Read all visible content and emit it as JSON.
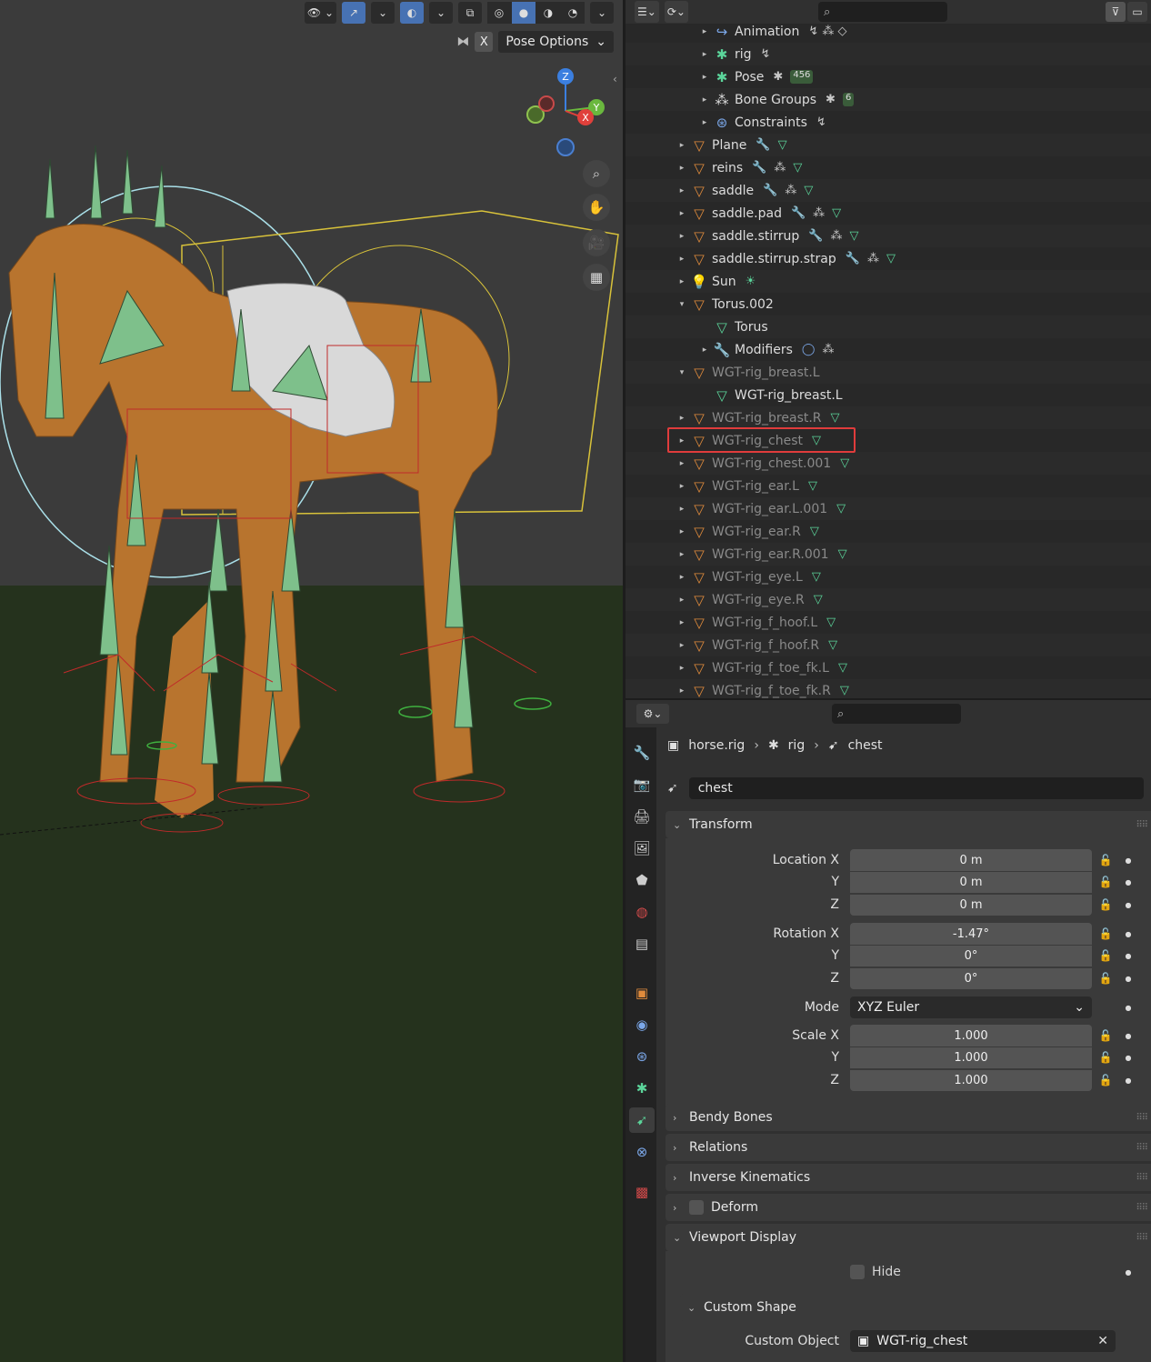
{
  "viewport": {
    "header_icons": [
      "visibility-icon",
      "gizmo-icon",
      "overlay-icon",
      "xray-icon",
      "wireframe-icon",
      "solid-icon",
      "material-icon",
      "rendered-icon"
    ],
    "x_toggle": "X",
    "pose_options": "Pose Options",
    "gizmo": {
      "z": "Z",
      "y": "Y",
      "x": "X"
    }
  },
  "outliner": {
    "rows": [
      {
        "label": "Animation",
        "icon": "animation-icon",
        "indent": 2,
        "expand": "▸"
      },
      {
        "label": "rig",
        "icon": "armature-icon",
        "indent": 2,
        "expand": "▸"
      },
      {
        "label": "Pose",
        "icon": "pose-icon",
        "indent": 2,
        "expand": "▸",
        "badge": "456"
      },
      {
        "label": "Bone Groups",
        "icon": "bone-groups-icon",
        "indent": 2,
        "expand": "▸",
        "badge": "6"
      },
      {
        "label": "Constraints",
        "icon": "constraints-icon",
        "indent": 2,
        "expand": "▸"
      },
      {
        "label": "Plane",
        "icon": "mesh-icon",
        "indent": 1,
        "expand": "▸"
      },
      {
        "label": "reins",
        "icon": "mesh-icon",
        "indent": 1,
        "expand": "▸"
      },
      {
        "label": "saddle",
        "icon": "mesh-icon",
        "indent": 1,
        "expand": "▸"
      },
      {
        "label": "saddle.pad",
        "icon": "mesh-icon",
        "indent": 1,
        "expand": "▸"
      },
      {
        "label": "saddle.stirrup",
        "icon": "mesh-icon",
        "indent": 1,
        "expand": "▸"
      },
      {
        "label": "saddle.stirrup.strap",
        "icon": "mesh-icon",
        "indent": 1,
        "expand": "▸"
      },
      {
        "label": "Sun",
        "icon": "light-icon",
        "indent": 1,
        "expand": "▸"
      },
      {
        "label": "Torus.002",
        "icon": "mesh-icon",
        "indent": 1,
        "expand": "▾"
      },
      {
        "label": "Torus",
        "icon": "mesh-data-icon",
        "indent": 2,
        "expand": ""
      },
      {
        "label": "Modifiers",
        "icon": "modifier-icon",
        "indent": 2,
        "expand": "▸"
      },
      {
        "label": "WGT-rig_breast.L",
        "icon": "mesh-icon",
        "indent": 1,
        "expand": "▾",
        "dim": true
      },
      {
        "label": "WGT-rig_breast.L",
        "icon": "mesh-data-icon",
        "indent": 2,
        "expand": ""
      },
      {
        "label": "WGT-rig_breast.R",
        "icon": "mesh-icon",
        "indent": 1,
        "expand": "▸",
        "dim": true
      },
      {
        "label": "WGT-rig_chest",
        "icon": "mesh-icon",
        "indent": 1,
        "expand": "▸",
        "dim": true
      },
      {
        "label": "WGT-rig_chest.001",
        "icon": "mesh-icon",
        "indent": 1,
        "expand": "▸",
        "dim": true
      },
      {
        "label": "WGT-rig_ear.L",
        "icon": "mesh-icon",
        "indent": 1,
        "expand": "▸",
        "dim": true
      },
      {
        "label": "WGT-rig_ear.L.001",
        "icon": "mesh-icon",
        "indent": 1,
        "expand": "▸",
        "dim": true
      },
      {
        "label": "WGT-rig_ear.R",
        "icon": "mesh-icon",
        "indent": 1,
        "expand": "▸",
        "dim": true
      },
      {
        "label": "WGT-rig_ear.R.001",
        "icon": "mesh-icon",
        "indent": 1,
        "expand": "▸",
        "dim": true
      },
      {
        "label": "WGT-rig_eye.L",
        "icon": "mesh-icon",
        "indent": 1,
        "expand": "▸",
        "dim": true
      },
      {
        "label": "WGT-rig_eye.R",
        "icon": "mesh-icon",
        "indent": 1,
        "expand": "▸",
        "dim": true
      },
      {
        "label": "WGT-rig_f_hoof.L",
        "icon": "mesh-icon",
        "indent": 1,
        "expand": "▸",
        "dim": true
      },
      {
        "label": "WGT-rig_f_hoof.R",
        "icon": "mesh-icon",
        "indent": 1,
        "expand": "▸",
        "dim": true
      },
      {
        "label": "WGT-rig_f_toe_fk.L",
        "icon": "mesh-icon",
        "indent": 1,
        "expand": "▸",
        "dim": true
      },
      {
        "label": "WGT-rig_f_toe_fk.R",
        "icon": "mesh-icon",
        "indent": 1,
        "expand": "▸",
        "dim": true
      }
    ]
  },
  "properties": {
    "breadcrumb": [
      "horse.rig",
      "rig",
      "chest"
    ],
    "bone_name": "chest",
    "transform": {
      "title": "Transform",
      "location_label": "Location X",
      "location": [
        "0 m",
        "0 m",
        "0 m"
      ],
      "rotation_label": "Rotation X",
      "rotation": [
        "-1.47°",
        "0°",
        "0°"
      ],
      "mode_label": "Mode",
      "mode": "XYZ Euler",
      "scale_label": "Scale X",
      "scale": [
        "1.000",
        "1.000",
        "1.000"
      ],
      "y_label": "Y",
      "z_label": "Z"
    },
    "panels": {
      "bendy": "Bendy Bones",
      "relations": "Relations",
      "ik": "Inverse Kinematics",
      "deform": "Deform",
      "viewport_display": "Viewport Display",
      "hide": "Hide",
      "custom_shape": "Custom Shape",
      "custom_object_label": "Custom Object",
      "custom_object": "WGT-rig_chest"
    }
  }
}
